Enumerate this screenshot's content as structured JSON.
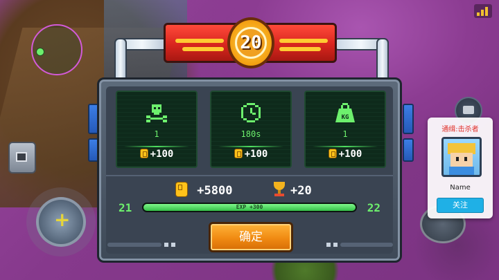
{
  "hud": {
    "minimap_label": "",
    "killer_panel": {
      "title": "通缉:击杀者",
      "name": "Name",
      "follow_label": "关注"
    }
  },
  "result": {
    "level_badge": "20",
    "stats": [
      {
        "icon": "skull-icon",
        "value": "1",
        "reward": "+100"
      },
      {
        "icon": "clock-icon",
        "value": "180s",
        "reward": "+100"
      },
      {
        "icon": "weight-icon",
        "value": "1",
        "reward": "+100"
      }
    ],
    "total_coins": "+5800",
    "total_trophies": "+20",
    "level_from": "21",
    "level_to": "22",
    "exp_label": "EXP +300",
    "exp_progress": 1.0,
    "confirm_label": "确定"
  },
  "colors": {
    "accent_green": "#6df06d",
    "banner_red": "#d8261e",
    "confirm_orange": "#f08a12",
    "follow_blue": "#1fb0e6"
  }
}
